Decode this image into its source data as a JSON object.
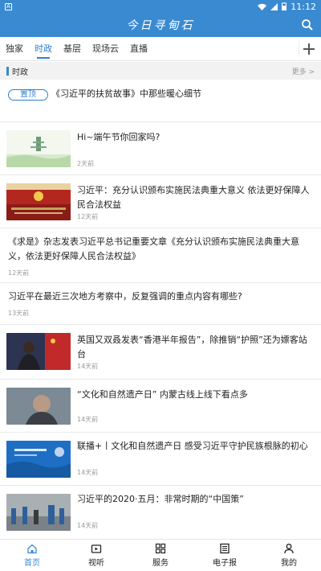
{
  "status_bar": {
    "time": "11:12",
    "app_icon": "A"
  },
  "app_title": "今日寻甸石",
  "tabs": [
    {
      "label": "独家",
      "active": false
    },
    {
      "label": "时政",
      "active": true
    },
    {
      "label": "基层",
      "active": false
    },
    {
      "label": "现场云",
      "active": false
    },
    {
      "label": "直播",
      "active": false
    }
  ],
  "section": {
    "title": "时政",
    "more": "更多 >"
  },
  "pinned": {
    "badge": "置顶",
    "title": "《习近平的扶贫故事》中那些暖心细节"
  },
  "news": [
    {
      "title": "Hi~端午节你回家吗?",
      "time": "2天前",
      "has_image": true
    },
    {
      "title": "习近平：充分认识颁布实施民法典重大意义 依法更好保障人民合法权益",
      "time": "12天前",
      "has_image": true
    },
    {
      "title": "《求是》杂志发表习近平总书记重要文章《充分认识颁布实施民法典重大意义，依法更好保障人民合法权益》",
      "time": "12天前",
      "has_image": false
    },
    {
      "title": "习近平在最近三次地方考察中，反复强调的重点内容有哪些?",
      "time": "13天前",
      "has_image": false
    },
    {
      "title": "英国又双叒发表“香港半年报告”，除推销“护照”还为嫖客站台",
      "time": "14天前",
      "has_image": true
    },
    {
      "title": "“文化和自然遗产日” 内蒙古线上线下看点多",
      "time": "14天前",
      "has_image": true
    },
    {
      "title": "联播+丨文化和自然遗产日 感受习近平守护民族根脉的初心",
      "time": "14天前",
      "has_image": true
    },
    {
      "title": "习近平的2020·五月：非常时期的“中国策”",
      "time": "14天前",
      "has_image": true
    }
  ],
  "bottom_nav": [
    {
      "label": "首页",
      "icon": "home-icon",
      "active": true
    },
    {
      "label": "视听",
      "icon": "video-icon",
      "active": false
    },
    {
      "label": "服务",
      "icon": "grid-icon",
      "active": false
    },
    {
      "label": "电子报",
      "icon": "newspaper-icon",
      "active": false
    },
    {
      "label": "我的",
      "icon": "person-icon",
      "active": false
    }
  ],
  "colors": {
    "primary": "#3a8ad2",
    "tab_active": "#2f7fd0",
    "divider": "#e8e8e8"
  }
}
